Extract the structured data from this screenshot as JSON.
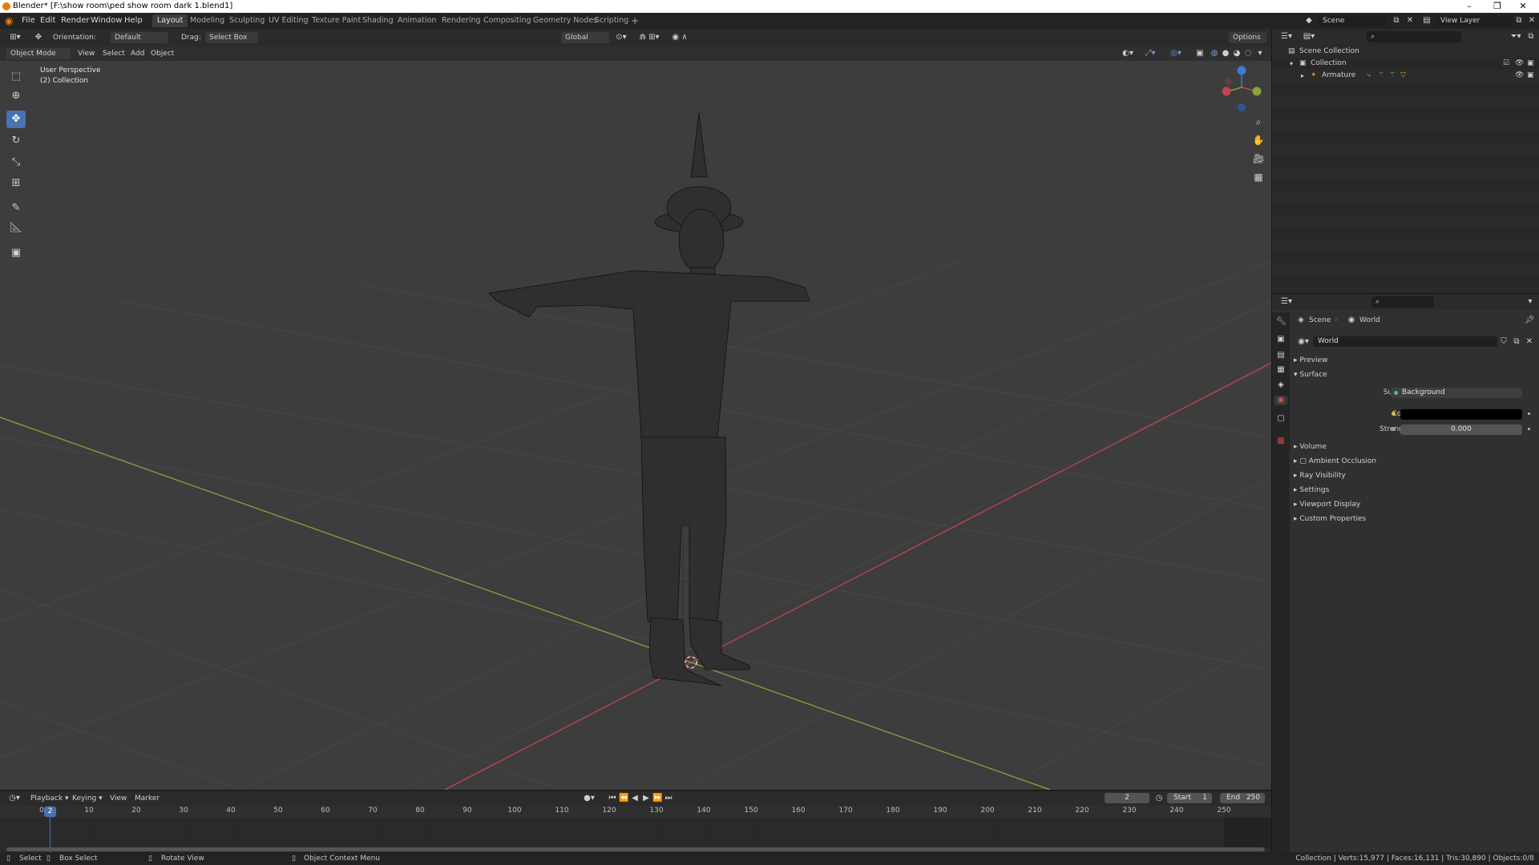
{
  "titlebar": {
    "title": "Blender* [F:\\show room\\ped show room dark 1.blend1]",
    "minimize": "–",
    "maximize": "❐",
    "close": "✕"
  },
  "menubar": {
    "menus": [
      "File",
      "Edit",
      "Render",
      "Window",
      "Help"
    ],
    "workspaces": [
      "Layout",
      "Modeling",
      "Sculpting",
      "UV Editing",
      "Texture Paint",
      "Shading",
      "Animation",
      "Rendering",
      "Compositing",
      "Geometry Nodes",
      "Scripting"
    ],
    "add_workspace": "+",
    "scene_value": "Scene",
    "view_layer_value": "View Layer"
  },
  "tool_header": {
    "orientation_label": "Orientation:",
    "orientation_value": "Default",
    "drag_label": "Drag:",
    "drag_value": "Select Box",
    "transform_orientation": "Global",
    "options": "Options"
  },
  "viewport_header": {
    "mode": "Object Mode",
    "menus": [
      "View",
      "Select",
      "Add",
      "Object"
    ]
  },
  "viewport": {
    "overlay_title": "User Perspective",
    "overlay_collection": "(2) Collection",
    "gizmo_axes": [
      "Z",
      "X",
      "Y"
    ]
  },
  "outliner": {
    "search_placeholder": "",
    "scene_collection": "Scene Collection",
    "collection": "Collection",
    "armature": "Armature"
  },
  "properties": {
    "search_placeholder": "",
    "breadcrumb_scene": "Scene",
    "breadcrumb_world": "World",
    "world_datablock": "World",
    "panels": {
      "preview": "Preview",
      "surface": "Surface",
      "volume": "Volume",
      "ambient_occlusion": "Ambient Occlusion",
      "ray_visibility": "Ray Visibility",
      "settings": "Settings",
      "viewport_display": "Viewport Display",
      "custom_properties": "Custom Properties"
    },
    "surface_label": "Surface",
    "surface_value": "Background",
    "color_label": "Color",
    "strength_label": "Strength",
    "strength_value": "0.000"
  },
  "timeline": {
    "menus": [
      "Playback",
      "Keying",
      "View",
      "Marker"
    ],
    "current_frame": "2",
    "start_label": "Start",
    "start_value": "1",
    "end_label": "End",
    "end_value": "250",
    "ruler": [
      "0",
      "10",
      "20",
      "30",
      "40",
      "50",
      "60",
      "70",
      "80",
      "90",
      "100",
      "110",
      "120",
      "130",
      "140",
      "150",
      "160",
      "170",
      "180",
      "190",
      "200",
      "210",
      "220",
      "230",
      "240",
      "250"
    ],
    "playhead_label": "2"
  },
  "statusbar": {
    "select": "Select",
    "box_select": "Box Select",
    "rotate_view": "Rotate View",
    "context_menu": "Object Context Menu",
    "stats": "Collection | Verts:15,977 | Faces:16,131 | Tris:30,890 | Objects:0/8"
  },
  "colors": {
    "accent": "#4772b3",
    "x_axis": "#c2454f",
    "y_axis": "#8ba33a",
    "z_axis": "#3d7bd6",
    "active_tab": "#3d3d3d"
  }
}
